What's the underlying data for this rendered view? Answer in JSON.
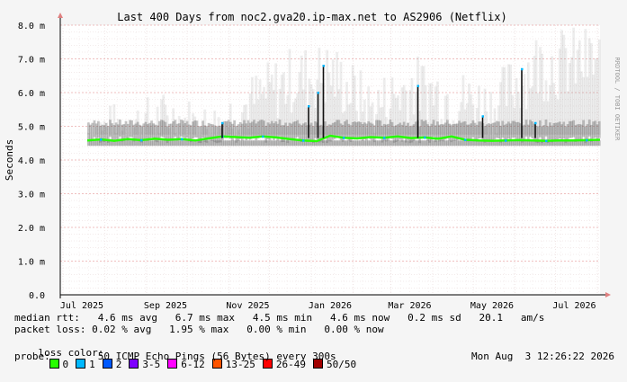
{
  "watermark": "RRDTOOL / TOBI OETIKER",
  "chart_data": {
    "type": "area",
    "title": "Last 400 Days from noc2.gva20.ip-max.net to AS2906 (Netflix)",
    "ylabel": "Seconds",
    "ylim": [
      0,
      8.0
    ],
    "y_ticks": [
      {
        "v": 0.0,
        "label": "0.0"
      },
      {
        "v": 1.0,
        "label": "1.0 m"
      },
      {
        "v": 2.0,
        "label": "2.0 m"
      },
      {
        "v": 3.0,
        "label": "3.0 m"
      },
      {
        "v": 4.0,
        "label": "4.0 m"
      },
      {
        "v": 5.0,
        "label": "5.0 m"
      },
      {
        "v": 6.0,
        "label": "6.0 m"
      },
      {
        "v": 7.0,
        "label": "7.0 m"
      },
      {
        "v": 8.0,
        "label": "8.0 m"
      }
    ],
    "x_ticks": [
      "Jul 2025",
      "Sep 2025",
      "Nov 2025",
      "Jan 2026",
      "Mar 2026",
      "May 2026",
      "Jul 2026"
    ],
    "grid": true,
    "series": [
      {
        "name": "median rtt",
        "unit": "ms",
        "x": [
          "2025-07-19",
          "2025-07-29",
          "2025-08-08",
          "2025-08-18",
          "2025-08-28",
          "2025-09-07",
          "2025-09-17",
          "2025-09-27",
          "2025-10-07",
          "2025-10-17",
          "2025-10-27",
          "2025-11-06",
          "2025-11-16",
          "2025-11-26",
          "2025-12-06",
          "2025-12-16",
          "2025-12-26",
          "2026-01-05",
          "2026-01-15",
          "2026-01-25",
          "2026-02-04",
          "2026-02-14",
          "2026-02-24",
          "2026-03-06",
          "2026-03-16",
          "2026-03-26",
          "2026-04-05",
          "2026-04-15",
          "2026-04-25",
          "2026-05-05",
          "2026-05-15",
          "2026-05-25",
          "2026-06-04",
          "2026-06-14",
          "2026-06-24",
          "2026-07-04",
          "2026-07-14",
          "2026-07-24",
          "2026-08-03"
        ],
        "values": [
          4.58,
          4.61,
          4.57,
          4.62,
          4.59,
          4.63,
          4.6,
          4.62,
          4.58,
          4.64,
          4.7,
          4.68,
          4.66,
          4.7,
          4.67,
          4.62,
          4.58,
          4.56,
          4.72,
          4.66,
          4.64,
          4.68,
          4.66,
          4.7,
          4.65,
          4.67,
          4.63,
          4.7,
          4.6,
          4.58,
          4.57,
          4.58,
          4.59,
          4.58,
          4.57,
          4.58,
          4.58,
          4.59,
          4.6
        ]
      }
    ],
    "spikes": [
      {
        "x": "2025-10-27",
        "value": 5.1
      },
      {
        "x": "2025-12-30",
        "value": 5.6
      },
      {
        "x": "2026-01-06",
        "value": 6.0
      },
      {
        "x": "2026-01-10",
        "value": 6.8
      },
      {
        "x": "2026-03-21",
        "value": 6.2
      },
      {
        "x": "2026-05-08",
        "value": 5.3
      },
      {
        "x": "2026-06-06",
        "value": 6.7
      },
      {
        "x": "2026-06-16",
        "value": 5.1
      }
    ],
    "smoke_upper": [
      {
        "x": "2025-07-19",
        "value": 5.6
      },
      {
        "x": "2025-08-18",
        "value": 5.8
      },
      {
        "x": "2025-09-17",
        "value": 6.1
      },
      {
        "x": "2025-10-17",
        "value": 5.7
      },
      {
        "x": "2025-11-16",
        "value": 6.6
      },
      {
        "x": "2025-12-16",
        "value": 7.4
      },
      {
        "x": "2026-01-15",
        "value": 7.6
      },
      {
        "x": "2026-02-14",
        "value": 6.4
      },
      {
        "x": "2026-03-16",
        "value": 7.2
      },
      {
        "x": "2026-04-15",
        "value": 6.8
      },
      {
        "x": "2026-05-15",
        "value": 6.5
      },
      {
        "x": "2026-06-14",
        "value": 7.9
      },
      {
        "x": "2026-07-14",
        "value": 8.0
      },
      {
        "x": "2026-08-03",
        "value": 8.0
      }
    ],
    "x_start": "2025-06-29",
    "x_end": "2026-08-03"
  },
  "stats": {
    "median_rtt": "median rtt:   4.6 ms avg   6.7 ms max   4.5 ms min   4.6 ms now   0.2 ms sd   20.1   am/s",
    "packet_loss": "packet loss: 0.02 % avg   1.95 % max   0.00 % min   0.00 % now",
    "loss_color_label": "loss color:",
    "probe": "probe:        50 ICMP Echo Pings (56 Bytes) every 300s",
    "timestamp": "Mon Aug  3 12:26:22 2026"
  },
  "loss_colors": [
    {
      "label": "0",
      "color": "#26ff00"
    },
    {
      "label": "1",
      "color": "#00b8ff"
    },
    {
      "label": "2",
      "color": "#0059ff"
    },
    {
      "label": "3-5",
      "color": "#7e00ff"
    },
    {
      "label": "6-12",
      "color": "#ff00ff"
    },
    {
      "label": "13-25",
      "color": "#ff5500"
    },
    {
      "label": "26-49",
      "color": "#ff0000"
    },
    {
      "label": "50/50",
      "color": "#a10000"
    }
  ],
  "colors": {
    "background": "#f5f5f5",
    "plot_bg": "#ffffff",
    "grid_minor": "#e8d8d8",
    "grid_major": "#e08080",
    "axis": "#000000",
    "median_line": "#26ff00",
    "smoke": "#9a9a9a"
  }
}
